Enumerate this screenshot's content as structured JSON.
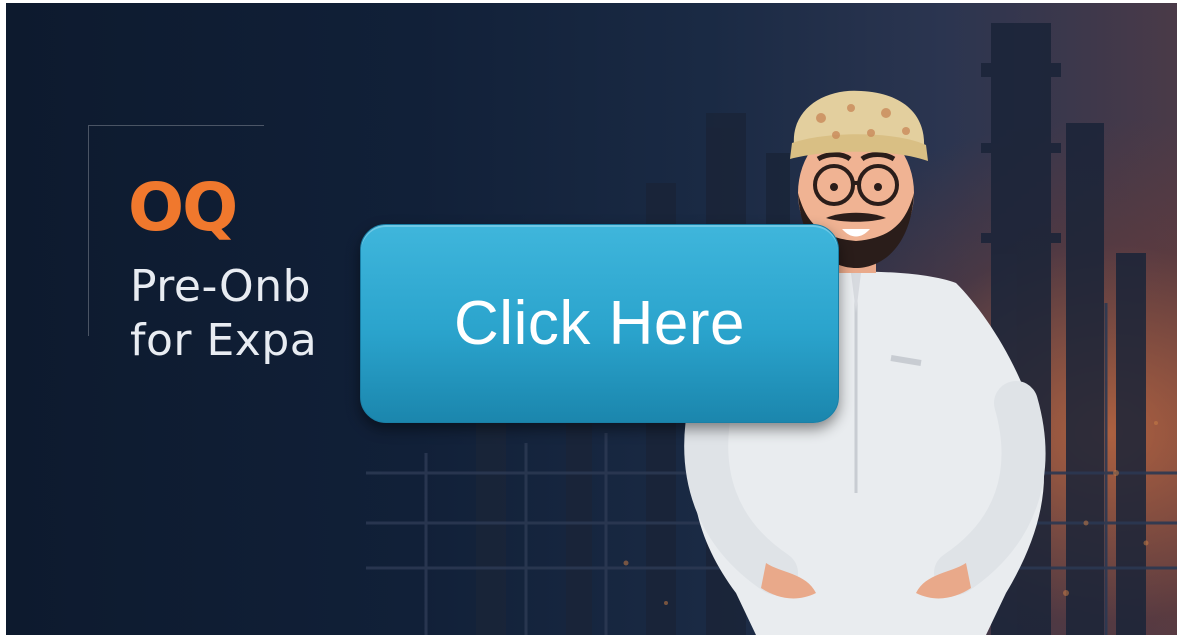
{
  "slide": {
    "logo_text": "OQ",
    "title_line_1": "Pre-Onb",
    "title_line_2": "for Expa",
    "cta_label": "Click Here"
  },
  "colors": {
    "logo_orange": "#f0782d",
    "button_blue": "#2aa3cc",
    "background_navy": "#112038"
  },
  "icons": {
    "logo": "oq-logo",
    "character": "omani-man-character",
    "background": "refinery-background"
  }
}
